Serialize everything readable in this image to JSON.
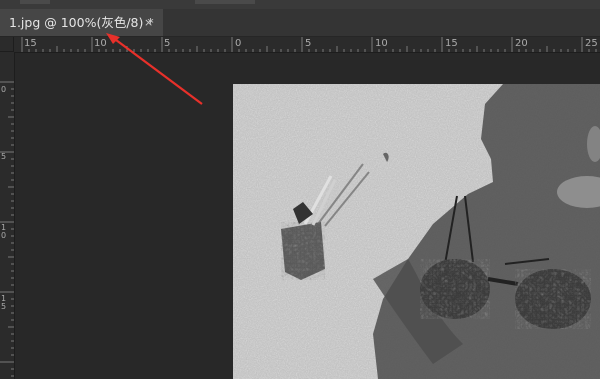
{
  "document_tab": {
    "title": "1.jpg @ 100%(灰色/8) *",
    "close_glyph": "×"
  },
  "ruler": {
    "horizontal_labels": [
      "15",
      "10",
      "5",
      "0",
      "5",
      "10",
      "15",
      "20",
      "25"
    ],
    "vertical_labels": [
      "0",
      "5",
      "1\n0",
      "1\n5"
    ]
  },
  "image": {
    "description_icon": "grayscale-photo",
    "mode": "grayscale"
  },
  "annotation": {
    "color": "#e8302a"
  }
}
